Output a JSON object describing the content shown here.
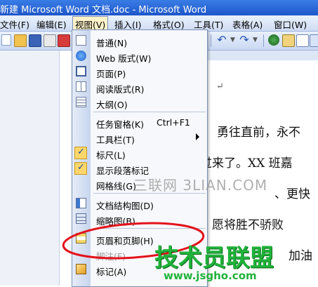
{
  "window": {
    "title": "新建 Microsoft Word 文档.doc - Microsoft Word"
  },
  "menubar": {
    "items": [
      "文件(F)",
      "编辑(E)",
      "视图(V)",
      "插入(I)",
      "格式(O)",
      "工具(T)",
      "表格(A)",
      "窗口(W)"
    ],
    "active": "视图(V)"
  },
  "view_menu": {
    "items": [
      {
        "label": "普通(N)",
        "icon": "normal-view-icon"
      },
      {
        "label": "Web 版式(W)",
        "icon": "web-layout-icon"
      },
      {
        "label": "页面(P)",
        "icon": "print-layout-icon"
      },
      {
        "label": "阅读版式(R)",
        "icon": "reading-layout-icon"
      },
      {
        "label": "大纲(O)",
        "icon": "outline-view-icon"
      },
      {
        "label": "任务窗格(K)",
        "shortcut": "Ctrl+F1"
      },
      {
        "label": "工具栏(T)",
        "submenu": true
      },
      {
        "label": "标尺(L)",
        "checked": true
      },
      {
        "label": "显示段落标记",
        "checked": true
      },
      {
        "label": "网格线(G)"
      },
      {
        "label": "文档结构图(D)",
        "icon": "document-map-icon"
      },
      {
        "label": "缩略图(B)",
        "icon": "thumbnails-icon"
      },
      {
        "label": "页眉和页脚(H)",
        "icon": "header-footer-icon"
      },
      {
        "label": "脚注(F)",
        "disabled": true
      },
      {
        "label": "标记(A)",
        "icon": "markup-icon"
      }
    ]
  },
  "document": {
    "lines": [
      "勇往直前，永不",
      "过来了。XX 班嘉",
      "、更快",
      "，愿将胜不骄败",
      "加油"
    ],
    "paragraph_mark": "↵"
  },
  "watermarks": {
    "site1": "三联网 3LIAN.COM",
    "site2": "技术员联盟",
    "site2_url": "www.jsgho.com"
  },
  "colors": {
    "titlebar": "#1d56c9",
    "menu_highlight": "#fff3c9",
    "annotation": "#e3121b",
    "watermark_green": "#20b23a"
  }
}
